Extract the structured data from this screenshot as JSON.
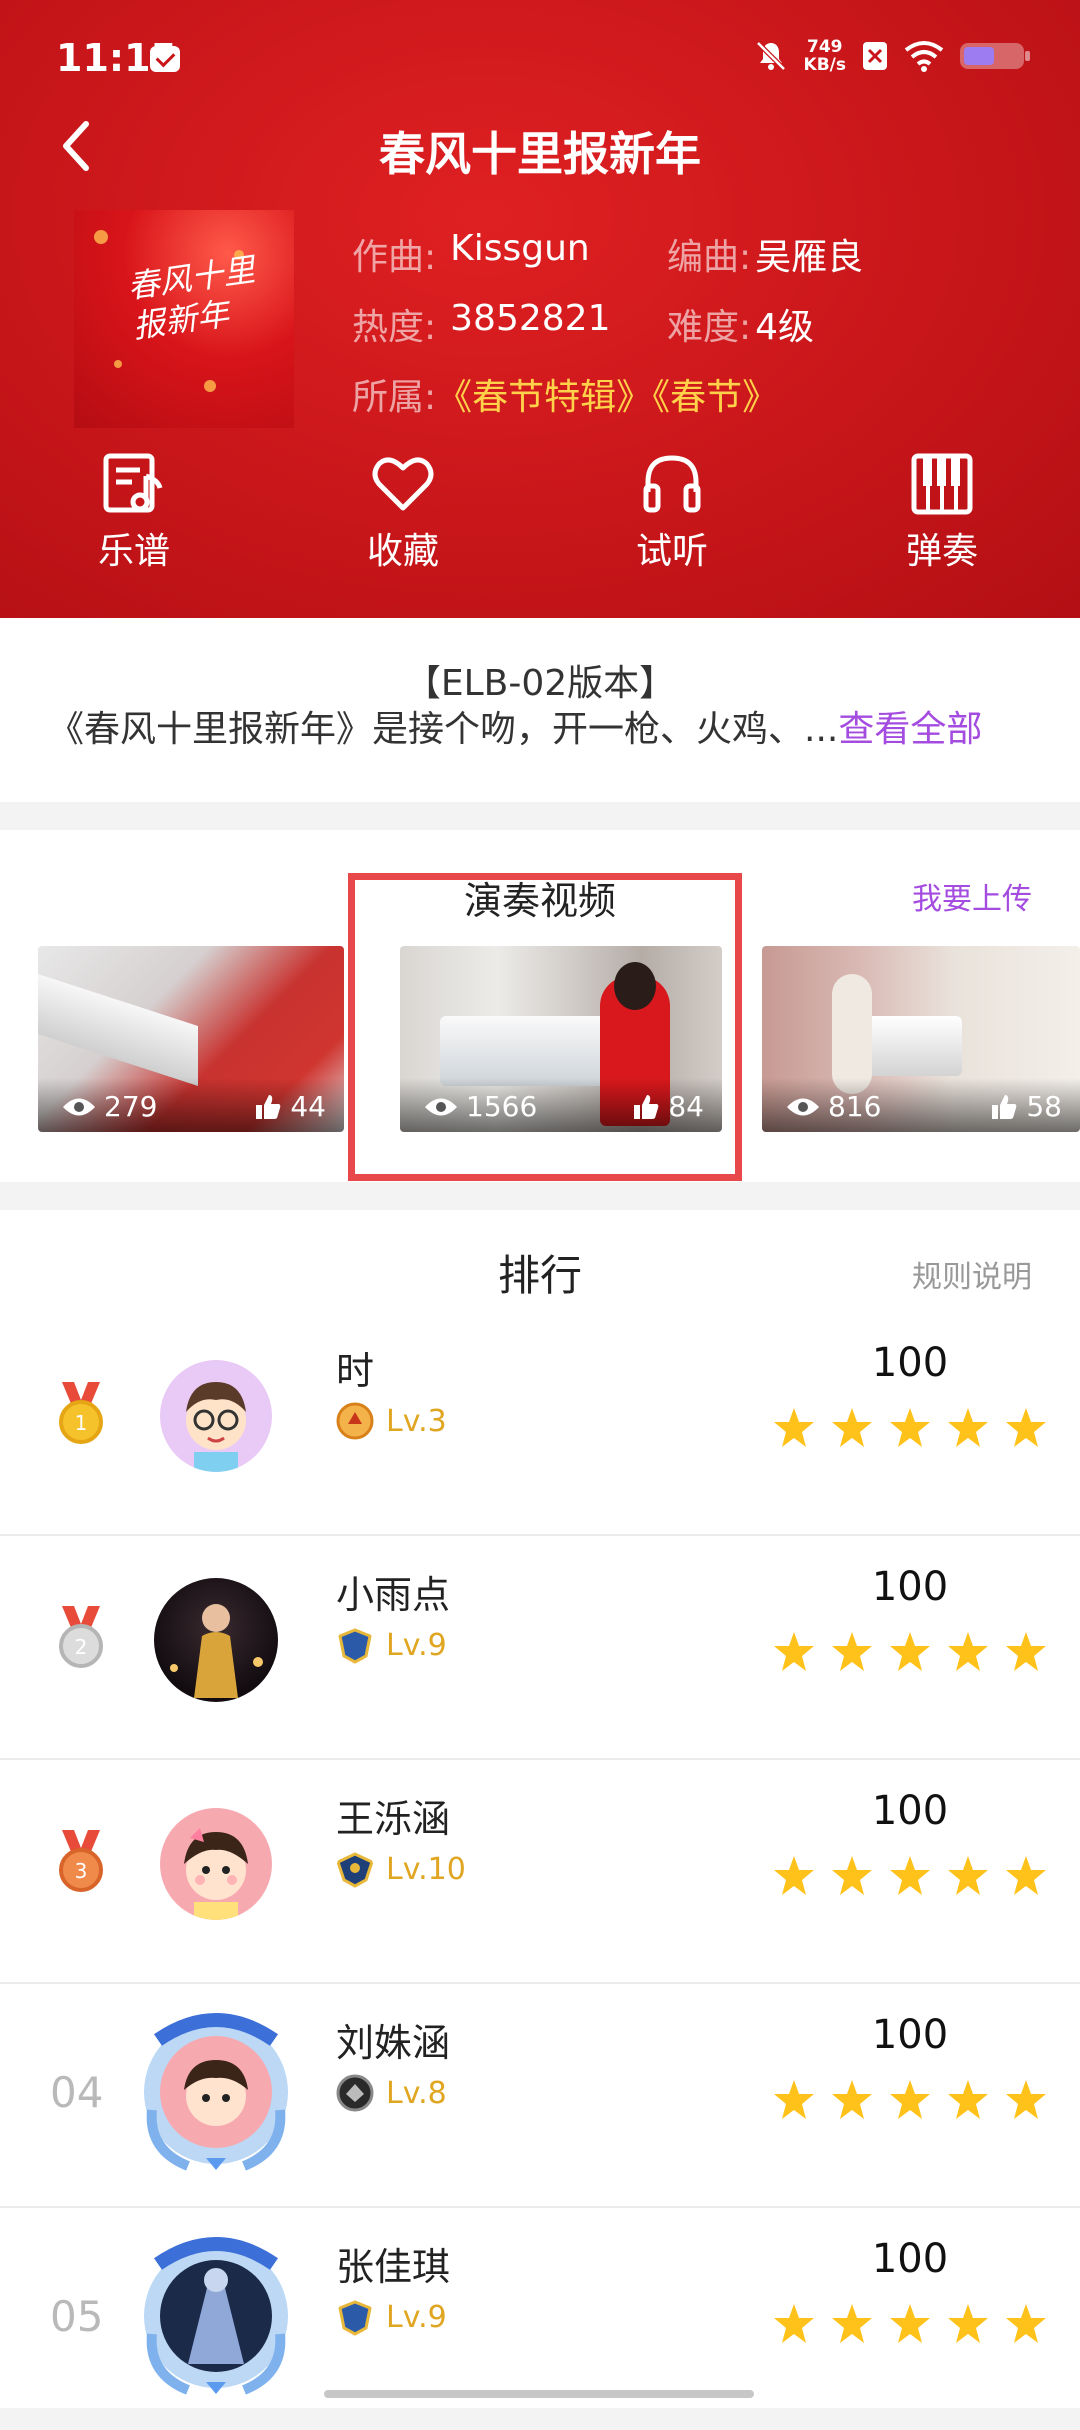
{
  "status_bar": {
    "time": "11:15",
    "net_speed_value": "749",
    "net_speed_unit": "KB/s"
  },
  "header": {
    "title": "春风十里报新年",
    "cover_text": "春风十里报新年",
    "composer_label": "作曲:",
    "composer": "Kissgun",
    "arranger_label": "编曲:",
    "arranger": "吴雁良",
    "popularity_label": "热度:",
    "popularity": "3852821",
    "difficulty_label": "难度:",
    "difficulty": "4级",
    "belongs_label": "所属:",
    "belongs": "《春节特辑》《春节》"
  },
  "actions": [
    {
      "label": "乐谱",
      "icon": "music-score-icon"
    },
    {
      "label": "收藏",
      "icon": "heart-icon"
    },
    {
      "label": "试听",
      "icon": "headphones-icon"
    },
    {
      "label": "弹奏",
      "icon": "piano-icon"
    }
  ],
  "description": {
    "version": "【ELB-02版本】",
    "text": "《春风十里报新年》是接个吻，开一枪、火鸡、...",
    "view_all": "查看全部"
  },
  "videos": {
    "title": "演奏视频",
    "upload": "我要上传",
    "items": [
      {
        "views": "279",
        "likes": "44"
      },
      {
        "views": "1566",
        "likes": "84"
      },
      {
        "views": "816",
        "likes": "58"
      }
    ]
  },
  "ranking": {
    "title": "排行",
    "rules": "规则说明",
    "rows": [
      {
        "rank": "1",
        "name": "时",
        "level": "Lv.3",
        "score": "100",
        "stars": 5
      },
      {
        "rank": "2",
        "name": "小雨点",
        "level": "Lv.9",
        "score": "100",
        "stars": 5
      },
      {
        "rank": "3",
        "name": "王泺涵",
        "level": "Lv.10",
        "score": "100",
        "stars": 5
      },
      {
        "rank": "04",
        "name": "刘姝涵",
        "level": "Lv.8",
        "score": "100",
        "stars": 5
      },
      {
        "rank": "05",
        "name": "张佳琪",
        "level": "Lv.9",
        "score": "100",
        "stars": 5
      }
    ]
  },
  "colors": {
    "header_red": "#c8161a",
    "accent_purple": "#a44be0",
    "gold": "#ffd24a",
    "star": "#ffc21a",
    "highlight": "#e8484a"
  }
}
